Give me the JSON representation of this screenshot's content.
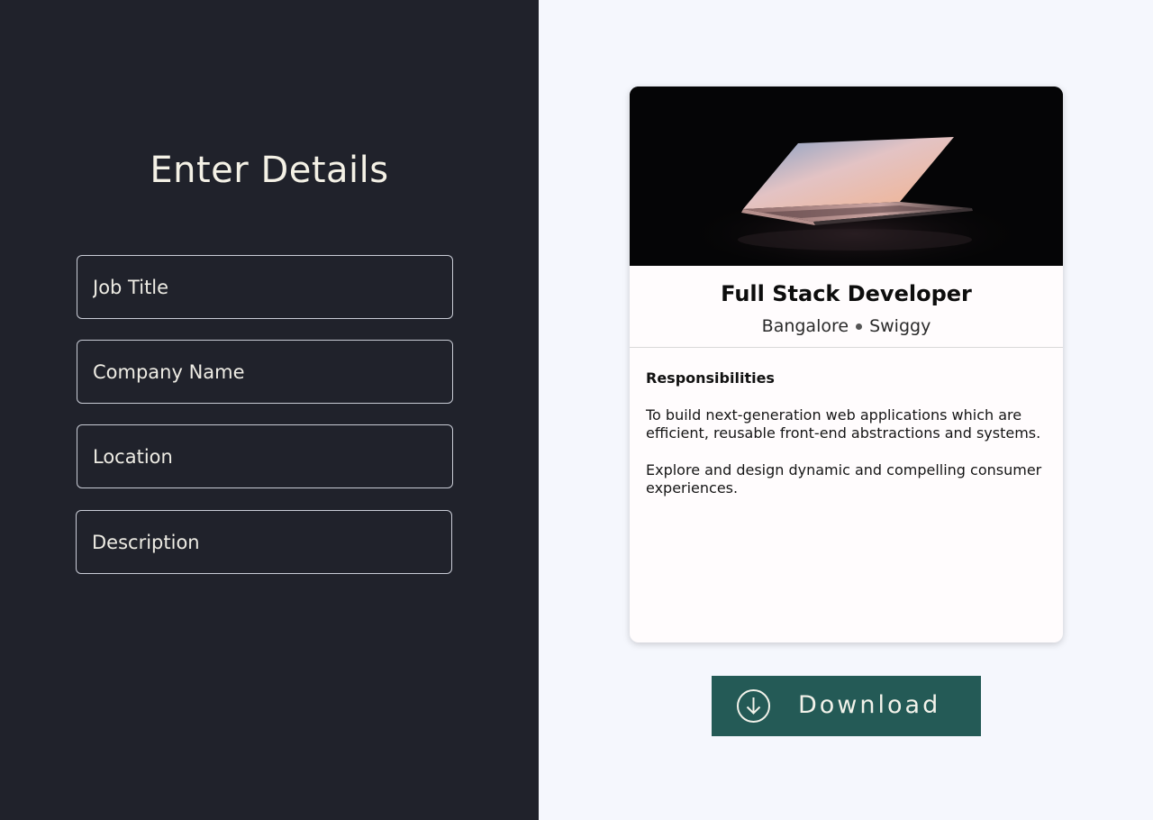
{
  "form": {
    "title": "Enter Details",
    "fields": [
      {
        "name": "job-title",
        "placeholder": "Job Title",
        "value": ""
      },
      {
        "name": "company-name",
        "placeholder": "Company Name",
        "value": ""
      },
      {
        "name": "location",
        "placeholder": "Location",
        "value": ""
      },
      {
        "name": "description",
        "placeholder": "Description",
        "value": ""
      }
    ]
  },
  "card": {
    "image_subject": "laptop-photo",
    "title": "Full Stack Developer",
    "location": "Bangalore",
    "company": "Swiggy",
    "section_title": "Responsibilities",
    "paragraphs": [
      "To build next-generation web applications which are efficient, reusable front-end abstractions and systems.",
      "Explore and design dynamic and compelling consumer experiences."
    ]
  },
  "download": {
    "label": "Download",
    "icon": "download-circle-icon"
  },
  "colors": {
    "left_panel_bg": "#20222b",
    "right_panel_bg": "#f5f7fd",
    "button_bg": "#245a56"
  }
}
